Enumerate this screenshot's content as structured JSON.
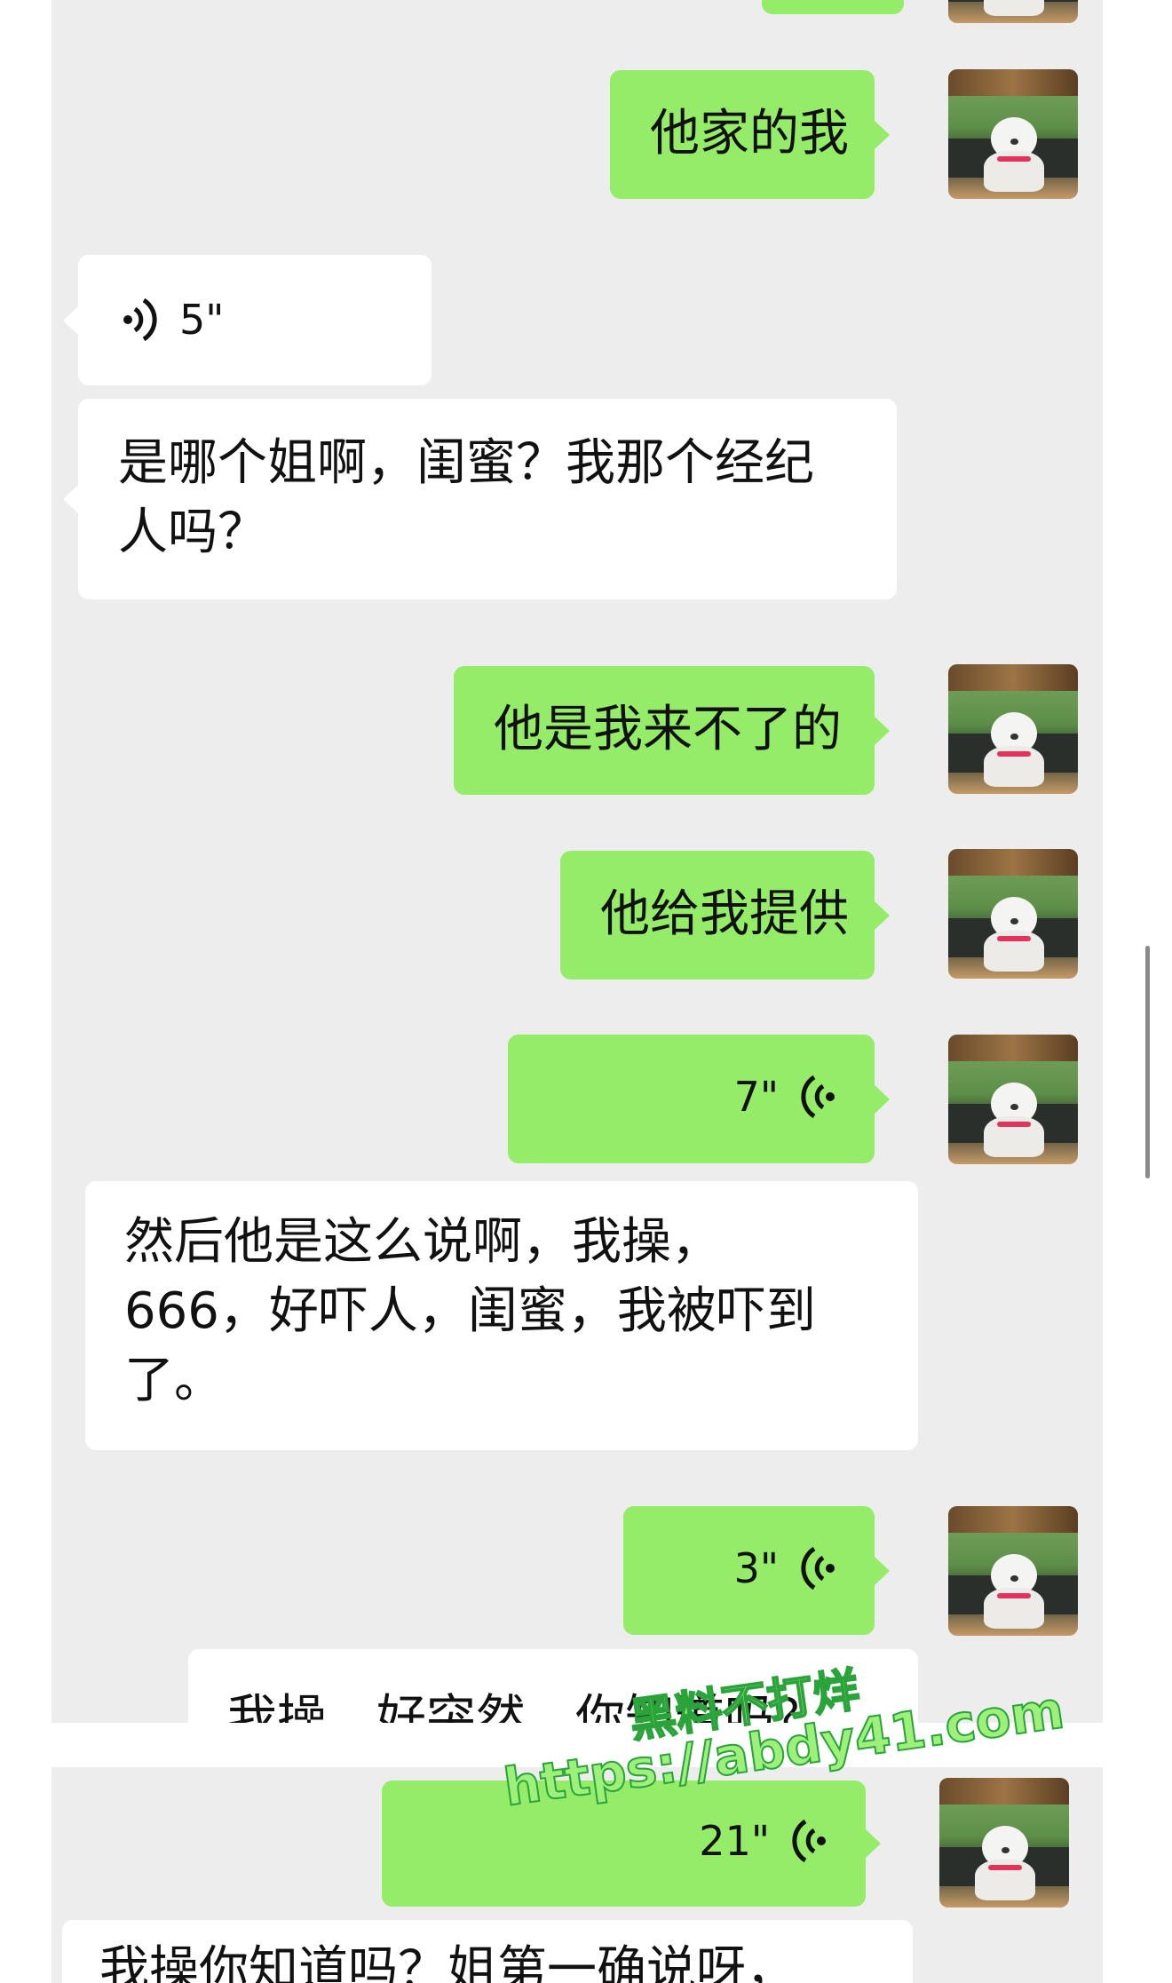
{
  "messages": [
    {
      "text": "他家的我"
    },
    {
      "duration": "5\""
    },
    {
      "text": "是哪个姐啊，闺蜜？我那个经纪\n人吗？"
    },
    {
      "text": "他是我来不了的"
    },
    {
      "text": "他给我提供"
    },
    {
      "duration": "7\""
    },
    {
      "text": "然后他是这么说啊，我操，\n666，好吓人，闺蜜，我被吓到\n了。"
    },
    {
      "duration": "3\""
    },
    {
      "text": "我操，好突然，你知道吗？"
    },
    {
      "duration": "21\""
    },
    {
      "text": "我操你知道吗？姐第一确说呀，"
    }
  ],
  "watermark": {
    "line1": "黑料不打烊",
    "line2": "https://abdy41.com"
  },
  "colors": {
    "sent_bubble": "#95ec69",
    "received_bubble": "#ffffff",
    "chat_bg": "#ededed"
  },
  "icons": {
    "voice_received": "voice-wave-icon",
    "voice_sent": "voice-wave-icon",
    "avatar": "dog-photo-avatar"
  }
}
